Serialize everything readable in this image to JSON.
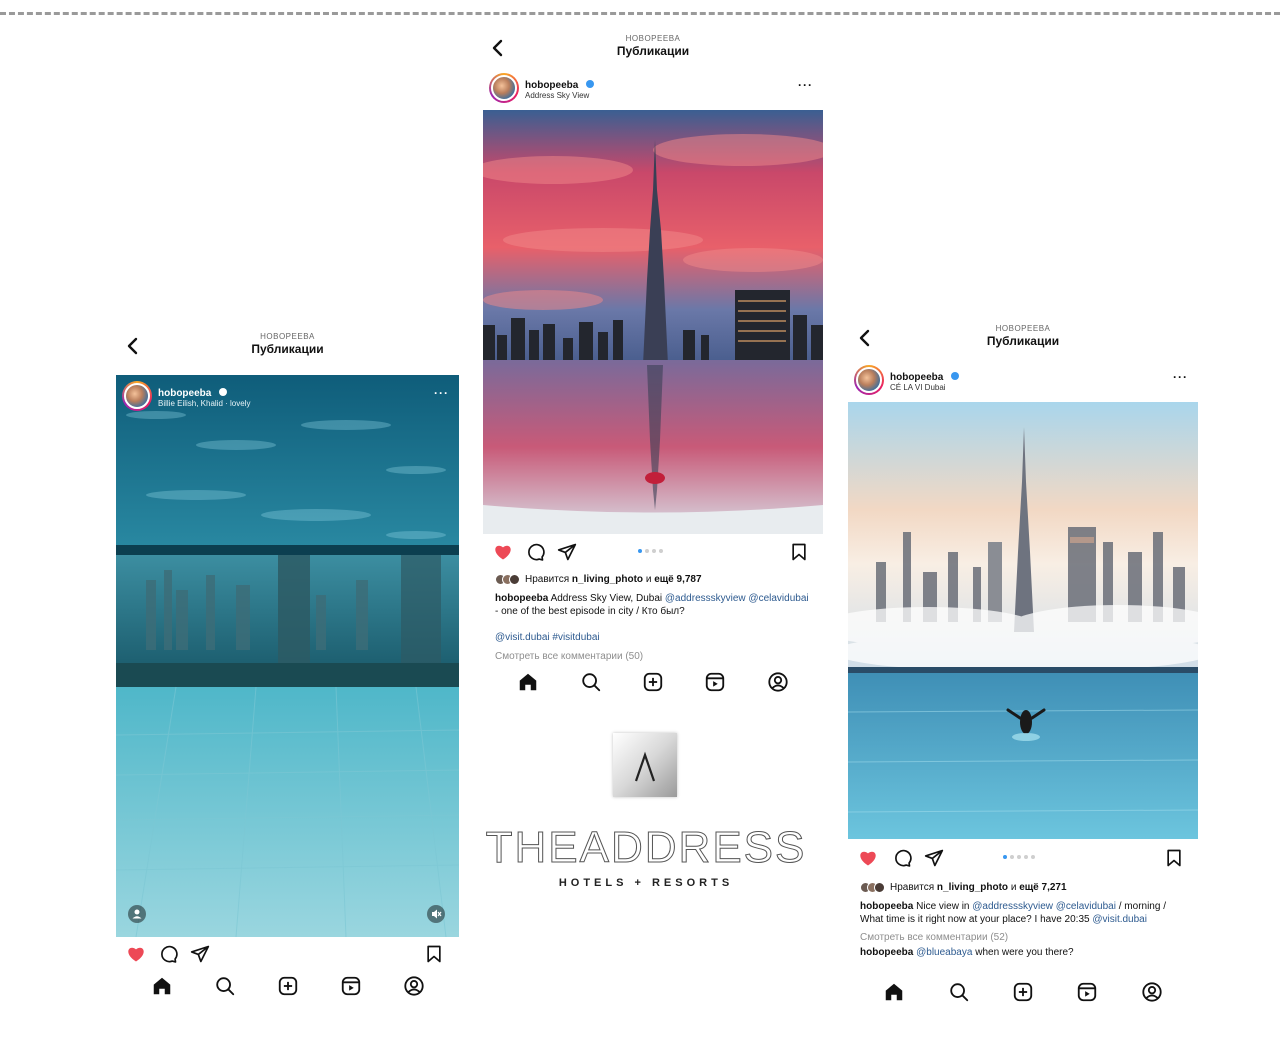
{
  "left": {
    "header": {
      "account": "HOBOPEEBA",
      "title": "Публикации"
    },
    "post": {
      "username": "hobopeeba",
      "subtitle": "Billie Eilish, Khalid · lovely"
    }
  },
  "center": {
    "header": {
      "account": "HOBOPEEBA",
      "title": "Публикации"
    },
    "post": {
      "username": "hobopeeba",
      "location": "Address Sky View",
      "likes_prefix": "Нравится",
      "likes_user": "n_living_photo",
      "likes_mid": "и",
      "likes_more": "ещё 9,787",
      "caption_user": "hobopeeba",
      "caption_text": "Address Sky View, Dubai",
      "caption_mention1": "@addressskyview",
      "caption_mention2": "@celavidubai",
      "caption_text2": "- one of the best episode in city / Кто был?",
      "caption_tags": "@visit.dubai #visitdubai",
      "view_comments": "Смотреть все комментарии (50)"
    },
    "brand": {
      "name": "THEADDRESS",
      "tagline": "HOTELS + RESORTS"
    }
  },
  "right": {
    "header": {
      "account": "HOBOPEEBA",
      "title": "Публикации"
    },
    "post": {
      "username": "hobopeeba",
      "location": "CÉ LA VI Dubai",
      "likes_prefix": "Нравится",
      "likes_user": "n_living_photo",
      "likes_mid": "и",
      "likes_more": "ещё 7,271",
      "caption_user": "hobopeeba",
      "caption_text": "Nice view in",
      "caption_mention1": "@addressskyview",
      "caption_mention2": "@celavidubai",
      "caption_text2": "/ morning / What time is it right now at your place? I have 20:35",
      "caption_mention3": "@visit.dubai",
      "view_comments": "Смотреть все комментарии (52)",
      "comment_user": "hobopeeba",
      "comment_mention": "@blueabaya",
      "comment_text": "when were you there?"
    }
  },
  "colors": {
    "like_red": "#ed4956",
    "link_blue": "#2d5a8f",
    "verified_blue": "#3897f0"
  },
  "icons": [
    "back-icon",
    "more-icon",
    "heart-icon",
    "comment-icon",
    "share-icon",
    "bookmark-icon",
    "home-icon",
    "search-icon",
    "add-icon",
    "reels-icon",
    "profile-icon",
    "mute-icon",
    "user-tag-icon"
  ]
}
